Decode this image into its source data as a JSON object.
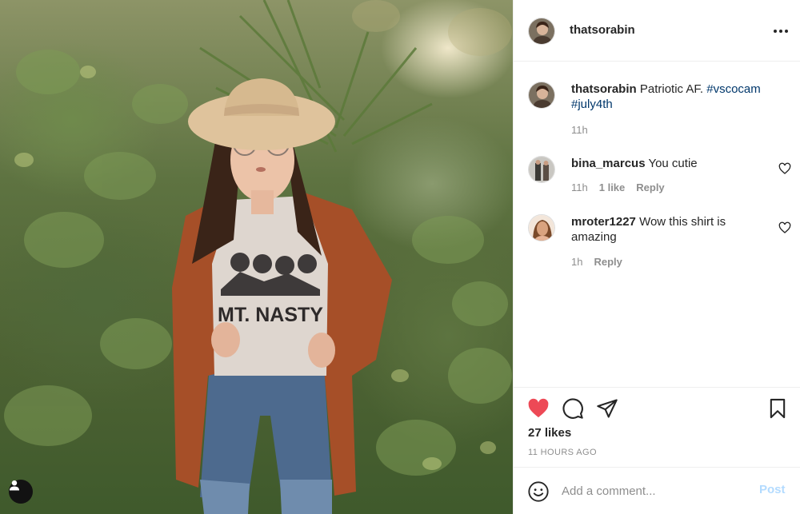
{
  "post": {
    "author": "thatsorabin",
    "more_icon": "more-horizontal-icon",
    "caption": {
      "username": "thatsorabin",
      "text": "Patriotic AF.",
      "hashtags": [
        "#vscocam",
        "#july4th"
      ],
      "time": "11h"
    },
    "image": {
      "shirt_text": "MT. NASTY",
      "user_tag_icon": "user-tag-icon"
    }
  },
  "comments": [
    {
      "username": "bina_marcus",
      "text": "You cutie",
      "time": "11h",
      "likes": "1 like",
      "reply": "Reply"
    },
    {
      "username": "mroter1227",
      "text": "Wow this shirt is amazing",
      "time": "1h",
      "reply": "Reply"
    }
  ],
  "actions": {
    "like_icon": "heart-filled-icon",
    "comment_icon": "comment-icon",
    "share_icon": "share-icon",
    "save_icon": "bookmark-icon",
    "likes": "27 likes",
    "time_ago": "11 HOURS AGO"
  },
  "add_comment": {
    "placeholder": "Add a comment...",
    "post_label": "Post",
    "emoji_icon": "emoji-icon"
  },
  "colors": {
    "like_red": "#ed4956",
    "hashtag_blue": "#00376b",
    "post_disabled": "#b3dbff",
    "muted_gray": "#8e8e8e"
  }
}
